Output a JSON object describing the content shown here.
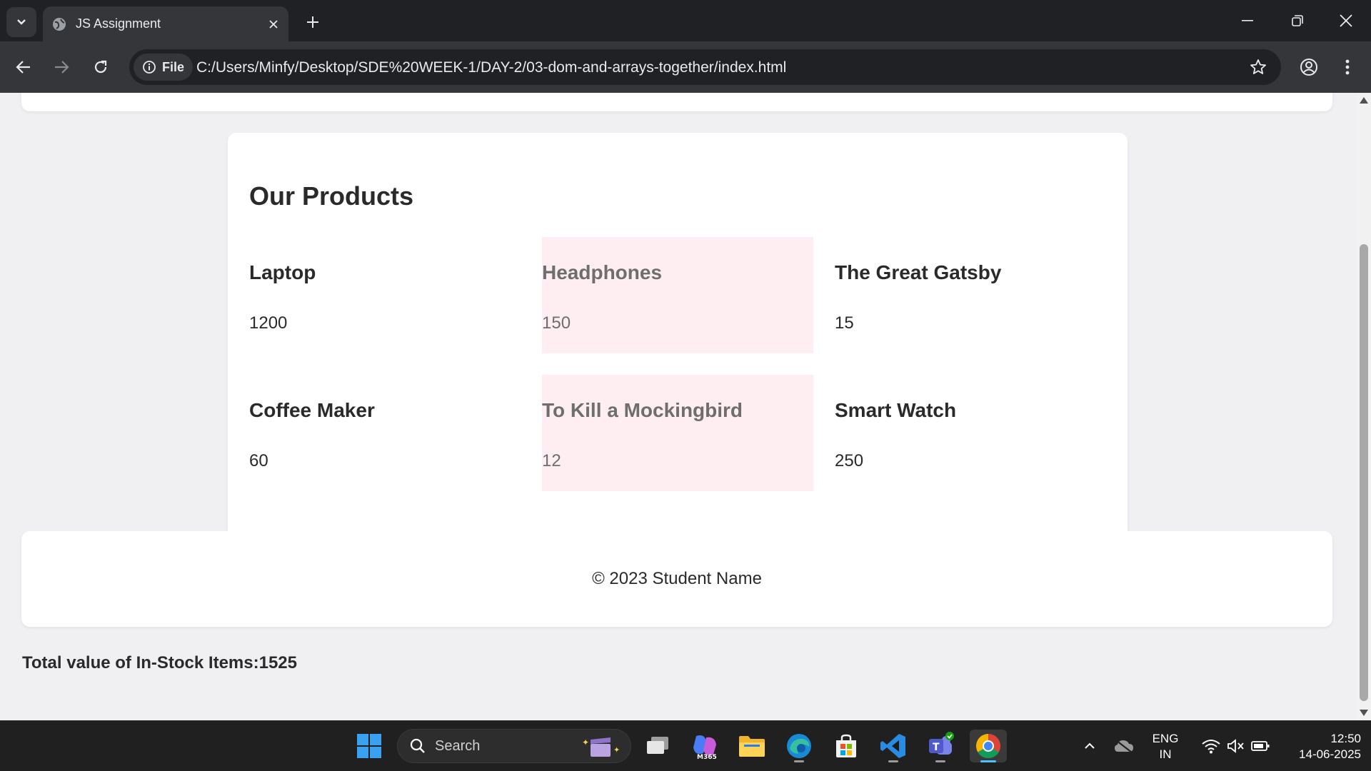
{
  "browser": {
    "tab_title": "JS Assignment",
    "site_chip_label": "File",
    "url": "C:/Users/Minfy/Desktop/SDE%20WEEK-1/DAY-2/03-dom-and-arrays-together/index.html"
  },
  "page": {
    "products_heading": "Our Products",
    "products": [
      {
        "name": "Laptop",
        "price": "1200",
        "in_stock": true
      },
      {
        "name": "Headphones",
        "price": "150",
        "in_stock": false
      },
      {
        "name": "The Great Gatsby",
        "price": "15",
        "in_stock": true
      },
      {
        "name": "Coffee Maker",
        "price": "60",
        "in_stock": true
      },
      {
        "name": "To Kill a Mockingbird",
        "price": "12",
        "in_stock": false
      },
      {
        "name": "Smart Watch",
        "price": "250",
        "in_stock": true
      }
    ],
    "footer_text": "© 2023 Student Name",
    "total_text": "Total value of In-Stock Items:1525"
  },
  "colors": {
    "out_of_stock_bg": "#ffeef1",
    "page_bg": "#f0f0f3",
    "taskbar_active": "#4cc2ff"
  },
  "taskbar": {
    "search_label": "Search",
    "lang_top": "ENG",
    "lang_bottom": "IN",
    "time": "12:50",
    "date": "14-06-2025",
    "apps": [
      "file-explorer-icon",
      "copilot-m365-icon",
      "folder-icon",
      "edge-icon",
      "store-icon",
      "vscode-icon",
      "teams-icon",
      "chrome-icon"
    ]
  }
}
